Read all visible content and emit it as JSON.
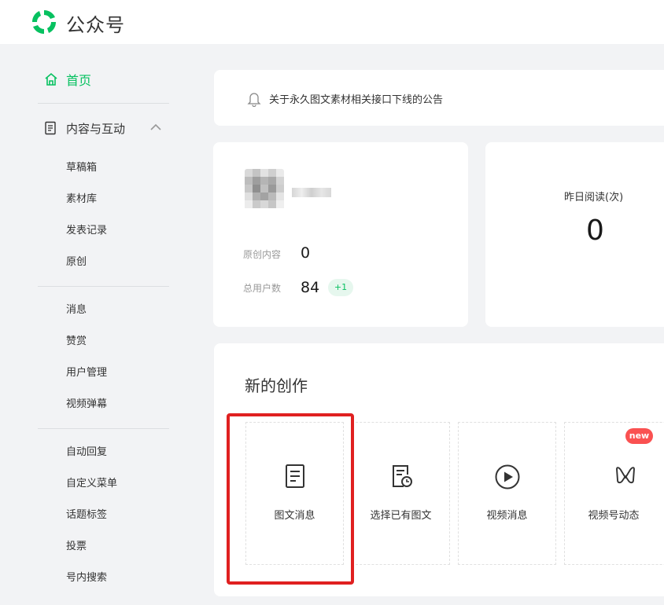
{
  "header": {
    "brand": "公众号",
    "logo_icon": "wechat-mp-logo"
  },
  "sidebar": {
    "home": "首页",
    "content_group": "内容与互动",
    "items": [
      "草稿箱",
      "素材库",
      "发表记录",
      "原创",
      "消息",
      "赞赏",
      "用户管理",
      "视频弹幕",
      "自动回复",
      "自定义菜单",
      "话题标签",
      "投票",
      "号内搜索"
    ]
  },
  "notice": {
    "text": "关于永久图文素材相关接口下线的公告"
  },
  "profile": {
    "original_label": "原创内容",
    "original_value": "0",
    "users_label": "总用户数",
    "users_value": "84",
    "users_delta": "+1"
  },
  "stats": {
    "yesterday_reads_label": "昨日阅读(次)",
    "yesterday_reads_value": "0"
  },
  "create": {
    "title": "新的创作",
    "tiles": [
      "图文消息",
      "选择已有图文",
      "视频消息",
      "视频号动态"
    ],
    "new_badge": "new"
  },
  "colors": {
    "accent": "#07c160",
    "highlight": "#e02020",
    "badge": "#fa5151"
  }
}
